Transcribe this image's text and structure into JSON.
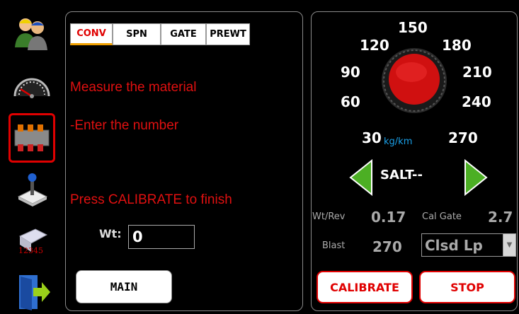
{
  "tabs": [
    "CONV",
    "SPN",
    "GATE",
    "PREWT"
  ],
  "messages": {
    "line1": "Measure the material",
    "line2": "-Enter the number",
    "line3": "Press CALIBRATE to finish"
  },
  "weight": {
    "label": "Wt:",
    "value": "0"
  },
  "main_button": "MAIN",
  "dial": {
    "scale": [
      "30",
      "60",
      "90",
      "120",
      "150",
      "180",
      "210",
      "240",
      "270"
    ],
    "unit": "kg/km"
  },
  "material": "SALT--",
  "wt_rev": {
    "label": "Wt/Rev",
    "value": "0.17"
  },
  "cal_gate": {
    "label": "Cal Gate",
    "value": "2.7"
  },
  "blast": {
    "label": "Blast",
    "value": "270"
  },
  "gate_select": {
    "value": "Clsd Lp"
  },
  "buttons": {
    "calibrate": "CALIBRATE",
    "stop": "STOP"
  },
  "colors": {
    "accent_red": "#e00000",
    "arrow_green": "#4caf24",
    "unit_blue": "#1aa0e8"
  }
}
